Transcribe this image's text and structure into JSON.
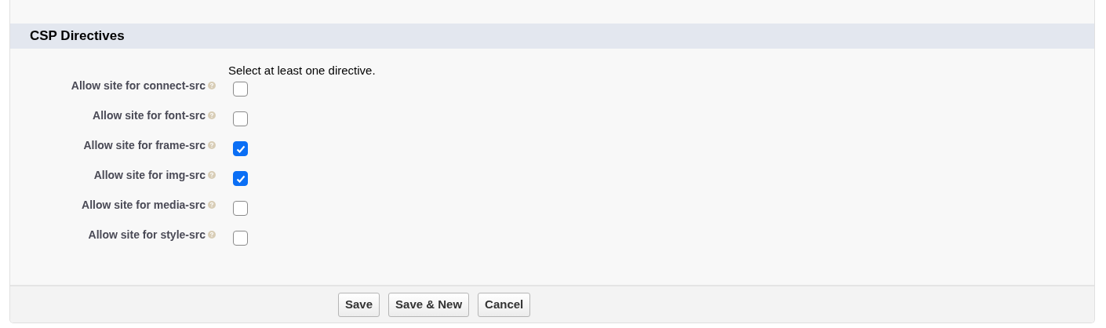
{
  "section": {
    "title": "CSP Directives"
  },
  "instruction": "Select at least one directive.",
  "directives": [
    {
      "label": "Allow site for connect-src",
      "checked": false
    },
    {
      "label": "Allow site for font-src",
      "checked": false
    },
    {
      "label": "Allow site for frame-src",
      "checked": true
    },
    {
      "label": "Allow site for img-src",
      "checked": true
    },
    {
      "label": "Allow site for media-src",
      "checked": false
    },
    {
      "label": "Allow site for style-src",
      "checked": false
    }
  ],
  "buttons": [
    "Save",
    "Save & New",
    "Cancel"
  ]
}
